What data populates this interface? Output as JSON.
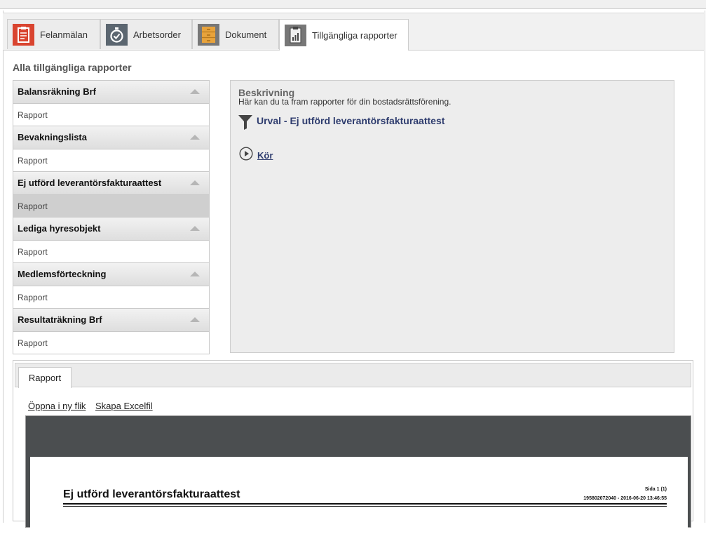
{
  "tabs": [
    {
      "label": "Felanmälan",
      "icon": "clipboard-icon",
      "color": "#d9442f"
    },
    {
      "label": "Arbetsorder",
      "icon": "stopwatch-icon",
      "color": "#5b6670"
    },
    {
      "label": "Dokument",
      "icon": "file-cabinet-icon",
      "color": "#e8a33c"
    },
    {
      "label": "Tillgängliga rapporter",
      "icon": "report-chart-icon",
      "color": "#777777"
    }
  ],
  "section_title": "Alla tillgängliga rapporter",
  "report_groups": [
    {
      "title": "Balansräkning Brf",
      "item": "Rapport"
    },
    {
      "title": "Bevakningslista",
      "item": "Rapport"
    },
    {
      "title": "Ej utförd leverantörsfakturaattest",
      "item": "Rapport"
    },
    {
      "title": "Lediga hyresobjekt",
      "item": "Rapport"
    },
    {
      "title": "Medlemsförteckning",
      "item": "Rapport"
    },
    {
      "title": "Resultaträkning Brf",
      "item": "Rapport"
    }
  ],
  "description": {
    "title": "Beskrivning",
    "text": "Här kan du ta fram rapporter för din bostadsrättsförening.",
    "filter_label": "Urval - Ej utförd leverantörsfakturaattest",
    "run_label": "Kör"
  },
  "report_panel": {
    "tab_label": "Rapport",
    "open_link": "Öppna i ny flik",
    "excel_link": "Skapa Excelfil",
    "page": {
      "title": "Ej utförd leverantörsfakturaattest",
      "page_info": "Sida 1 (1)",
      "stamp": "195802072040 - 2016-06-20 13:46:55"
    }
  },
  "colors": {
    "accent": "#2e3c6e",
    "selected_row": "#cfcfcf"
  }
}
